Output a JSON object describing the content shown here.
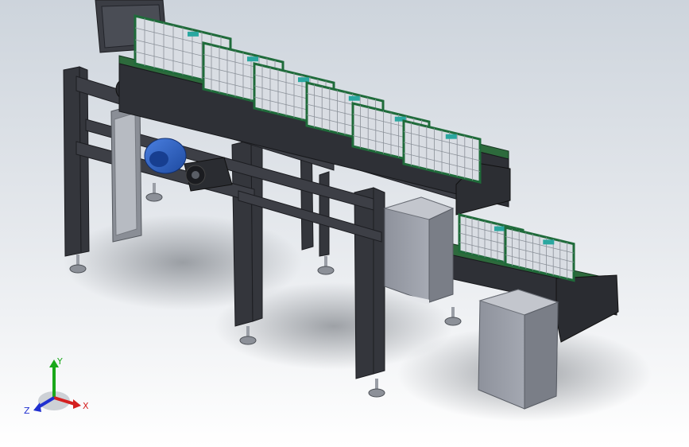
{
  "view": {
    "background_top": "#cdd4dc",
    "background_bottom": "#ffffff",
    "frame_color": "#3b3d44",
    "tray_green": "#1f6b3a",
    "tray_grid": "#d9dde3",
    "motor_blue": "#2f63c8",
    "cabinet_color": "#9ea2ad"
  },
  "triad": {
    "x_label": "X",
    "y_label": "Y",
    "z_label": "Z",
    "x_color": "#d42020",
    "y_color": "#1aa81a",
    "z_color": "#2030d0"
  }
}
